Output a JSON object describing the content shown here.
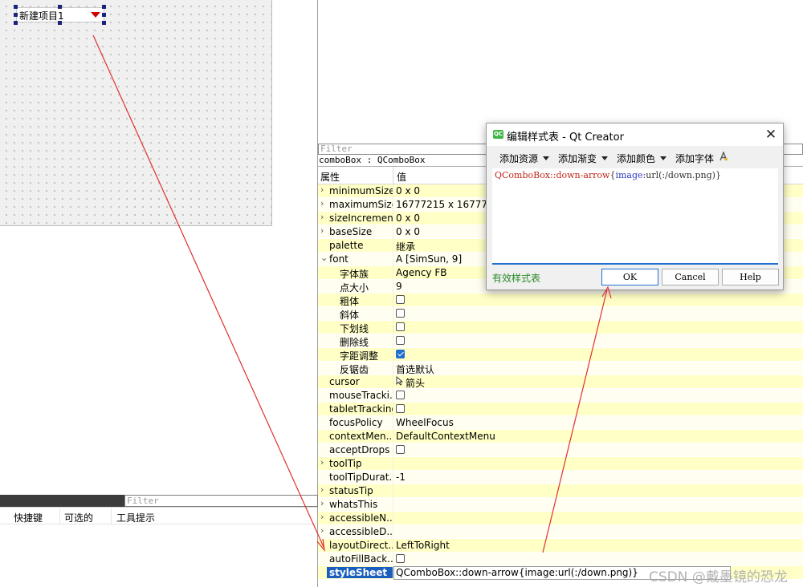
{
  "canvas": {
    "combo_text": "新建项目1"
  },
  "bottom_dock": {
    "filter_placeholder": "Filter",
    "headers": [
      "快捷键",
      "可选的",
      "工具提示"
    ]
  },
  "property_editor": {
    "filter_placeholder": "Filter",
    "object_label": "comboBox : QComboBox",
    "header_property": "属性",
    "header_value": "值",
    "rows": [
      {
        "name": "minimumSize",
        "value": "0 x 0"
      },
      {
        "name": "maximumSize",
        "value": "16777215 x 16777215"
      },
      {
        "name": "sizeIncrement",
        "value": "0 x 0"
      },
      {
        "name": "baseSize",
        "value": "0 x 0"
      },
      {
        "name": "palette",
        "value": "继承"
      },
      {
        "name": "font",
        "value": "A [SimSun, 9]"
      },
      {
        "name": "字体族",
        "value": "Agency FB"
      },
      {
        "name": "点大小",
        "value": "9"
      },
      {
        "name": "粗体",
        "value": ""
      },
      {
        "name": "斜体",
        "value": ""
      },
      {
        "name": "下划线",
        "value": ""
      },
      {
        "name": "删除线",
        "value": ""
      },
      {
        "name": "字距调整",
        "value": ""
      },
      {
        "name": "反锯齿",
        "value": "首选默认"
      },
      {
        "name": "cursor",
        "value": "箭头"
      },
      {
        "name": "mouseTracki...",
        "value": ""
      },
      {
        "name": "tabletTracking",
        "value": ""
      },
      {
        "name": "focusPolicy",
        "value": "WheelFocus"
      },
      {
        "name": "contextMen...",
        "value": "DefaultContextMenu"
      },
      {
        "name": "acceptDrops",
        "value": ""
      },
      {
        "name": "toolTip",
        "value": ""
      },
      {
        "name": "toolTipDurat...",
        "value": "-1"
      },
      {
        "name": "statusTip",
        "value": ""
      },
      {
        "name": "whatsThis",
        "value": ""
      },
      {
        "name": "accessibleN...",
        "value": ""
      },
      {
        "name": "accessibleD...",
        "value": ""
      },
      {
        "name": "layoutDirect...",
        "value": "LeftToRight"
      },
      {
        "name": "autoFillBack...",
        "value": ""
      },
      {
        "name": "styleSheet",
        "value": "QComboBox::down-arrow{image:url(:/down.png)}"
      }
    ],
    "checkbox_states": {
      "粗体": false,
      "斜体": false,
      "下划线": false,
      "删除线": false,
      "字距调整": true,
      "mouseTracki...": false,
      "tabletTracking": false,
      "acceptDrops": false,
      "autoFillBack...": false
    }
  },
  "dialog": {
    "title": "编辑样式表 - Qt Creator",
    "logo_text": "QC",
    "close_glyph": "✕",
    "toolbar": {
      "add_resource": "添加资源",
      "add_gradient": "添加渐变",
      "add_color": "添加颜色",
      "add_font": "添加字体"
    },
    "code": {
      "selector": "QComboBox::down-arrow",
      "brace_open": "{",
      "property": "image",
      "colon": ":",
      "value": "url(:/down.png)",
      "brace_close": "}"
    },
    "status": "有效样式表",
    "buttons": {
      "ok": "OK",
      "cancel": "Cancel",
      "help": "Help"
    }
  },
  "watermark": "CSDN @戴墨镜的恐龙",
  "colors": {
    "annotation_arrow": "#e03030",
    "selection": "#1a5fbf",
    "row_yellow": "#ffffc6",
    "valid_green": "#2a8a2a"
  }
}
